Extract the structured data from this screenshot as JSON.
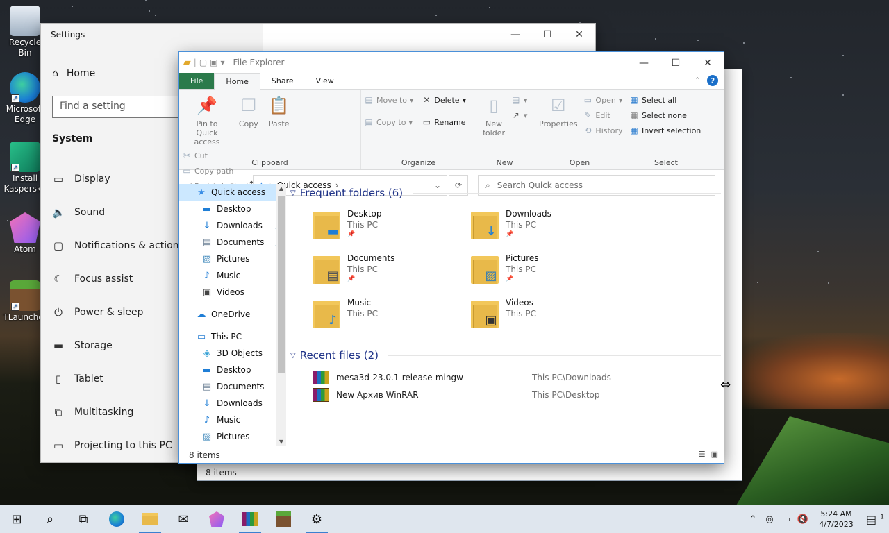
{
  "desktop": {
    "icons": [
      {
        "label": "Recycle Bin",
        "glyph": "🗑"
      },
      {
        "label": "Microsoft Edge",
        "glyph": "e"
      },
      {
        "label": "Install Kaspersky",
        "glyph": "K"
      },
      {
        "label": "Atom",
        "glyph": "⬢"
      },
      {
        "label": "TLauncher",
        "glyph": "▦"
      }
    ]
  },
  "settings": {
    "title": "Settings",
    "home": "Home",
    "search_placeholder": "Find a setting",
    "section": "System",
    "nav": [
      {
        "label": "Display",
        "icon": "display-icon",
        "glyph": "▭"
      },
      {
        "label": "Sound",
        "icon": "sound-icon",
        "glyph": "🔈"
      },
      {
        "label": "Notifications & actions",
        "icon": "notifications-icon",
        "glyph": "▢"
      },
      {
        "label": "Focus assist",
        "icon": "moon-icon",
        "glyph": "☾"
      },
      {
        "label": "Power & sleep",
        "icon": "power-icon",
        "glyph": "⏻"
      },
      {
        "label": "Storage",
        "icon": "storage-icon",
        "glyph": "▬"
      },
      {
        "label": "Tablet",
        "icon": "tablet-icon",
        "glyph": "▯"
      },
      {
        "label": "Multitasking",
        "icon": "multitasking-icon",
        "glyph": "⧉"
      },
      {
        "label": "Projecting to this PC",
        "icon": "projecting-icon",
        "glyph": "▭"
      }
    ]
  },
  "background_explorer": {
    "status": "8 items"
  },
  "explorer": {
    "title": "File Explorer",
    "tabs": [
      "File",
      "Home",
      "Share",
      "View"
    ],
    "ribbon": {
      "clipboard": {
        "label": "Clipboard",
        "pin": "Pin to Quick access",
        "copy": "Copy",
        "paste": "Paste",
        "cut": "Cut",
        "copy_path": "Copy path",
        "paste_shortcut": "Paste shortcut"
      },
      "organize": {
        "label": "Organize",
        "move_to": "Move to",
        "copy_to": "Copy to",
        "delete": "Delete",
        "rename": "Rename"
      },
      "new": {
        "label": "New",
        "new_folder": "New folder"
      },
      "open": {
        "label": "Open",
        "properties": "Properties",
        "open": "Open",
        "edit": "Edit",
        "history": "History"
      },
      "select": {
        "label": "Select",
        "select_all": "Select all",
        "select_none": "Select none",
        "invert": "Invert selection"
      }
    },
    "address": {
      "path": "Quick access",
      "search_placeholder": "Search Quick access"
    },
    "nav": [
      {
        "label": "Quick access",
        "indent": 0,
        "icon": "star-icon",
        "glyph": "★",
        "color": "#3a8ee6",
        "pinned": false,
        "selected": true
      },
      {
        "label": "Desktop",
        "indent": 1,
        "icon": "desktop-icon",
        "glyph": "▬",
        "color": "#1f7ed6",
        "pinned": true
      },
      {
        "label": "Downloads",
        "indent": 1,
        "icon": "downloads-icon",
        "glyph": "↓",
        "color": "#1f7ed6",
        "pinned": true
      },
      {
        "label": "Documents",
        "indent": 1,
        "icon": "documents-icon",
        "glyph": "▤",
        "color": "#6b7f94",
        "pinned": true
      },
      {
        "label": "Pictures",
        "indent": 1,
        "icon": "pictures-icon",
        "glyph": "▨",
        "color": "#4a8fbf",
        "pinned": true
      },
      {
        "label": "Music",
        "indent": 1,
        "icon": "music-icon",
        "glyph": "♪",
        "color": "#1f7ed6",
        "pinned": false
      },
      {
        "label": "Videos",
        "indent": 1,
        "icon": "videos-icon",
        "glyph": "▣",
        "color": "#444",
        "pinned": false
      },
      {
        "label": "OneDrive",
        "indent": 0,
        "icon": "onedrive-icon",
        "glyph": "☁",
        "color": "#1f7ed6",
        "pinned": false,
        "gap": true
      },
      {
        "label": "This PC",
        "indent": 0,
        "icon": "this-pc-icon",
        "glyph": "▭",
        "color": "#2a7fd4",
        "pinned": false,
        "gap": true
      },
      {
        "label": "3D Objects",
        "indent": 1,
        "icon": "3d-objects-icon",
        "glyph": "◈",
        "color": "#3aa3d6",
        "pinned": false
      },
      {
        "label": "Desktop",
        "indent": 1,
        "icon": "desktop-icon",
        "glyph": "▬",
        "color": "#1f7ed6",
        "pinned": false
      },
      {
        "label": "Documents",
        "indent": 1,
        "icon": "documents-icon",
        "glyph": "▤",
        "color": "#6b7f94",
        "pinned": false
      },
      {
        "label": "Downloads",
        "indent": 1,
        "icon": "downloads-icon",
        "glyph": "↓",
        "color": "#1f7ed6",
        "pinned": false
      },
      {
        "label": "Music",
        "indent": 1,
        "icon": "music-icon",
        "glyph": "♪",
        "color": "#1f7ed6",
        "pinned": false
      },
      {
        "label": "Pictures",
        "indent": 1,
        "icon": "pictures-icon",
        "glyph": "▨",
        "color": "#4a8fbf",
        "pinned": false
      }
    ],
    "frequent_header": "Frequent folders (6)",
    "frequent": [
      {
        "name": "Desktop",
        "location": "This PC",
        "pinned": true,
        "icon": "desktop-folder-icon",
        "glyph": "▬",
        "glyph_color": "#1f7ed6"
      },
      {
        "name": "Downloads",
        "location": "This PC",
        "pinned": true,
        "icon": "downloads-folder-icon",
        "glyph": "↓",
        "glyph_color": "#1f7ed6"
      },
      {
        "name": "Documents",
        "location": "This PC",
        "pinned": true,
        "icon": "documents-folder-icon",
        "glyph": "▤",
        "glyph_color": "#555"
      },
      {
        "name": "Pictures",
        "location": "This PC",
        "pinned": true,
        "icon": "pictures-folder-icon",
        "glyph": "▨",
        "glyph_color": "#3b7fb0"
      },
      {
        "name": "Music",
        "location": "This PC",
        "pinned": false,
        "icon": "music-folder-icon",
        "glyph": "♪",
        "glyph_color": "#1f7ed6"
      },
      {
        "name": "Videos",
        "location": "This PC",
        "pinned": false,
        "icon": "videos-folder-icon",
        "glyph": "▣",
        "glyph_color": "#333"
      }
    ],
    "recent_header": "Recent files (2)",
    "recent": [
      {
        "name": "mesa3d-23.0.1-release-mingw",
        "location": "This PC\\Downloads"
      },
      {
        "name": "New Архив WinRAR",
        "location": "This PC\\Desktop"
      }
    ],
    "status": "8 items"
  },
  "taskbar": {
    "time": "5:24 AM",
    "date": "4/7/2023",
    "notification_count": "1"
  }
}
